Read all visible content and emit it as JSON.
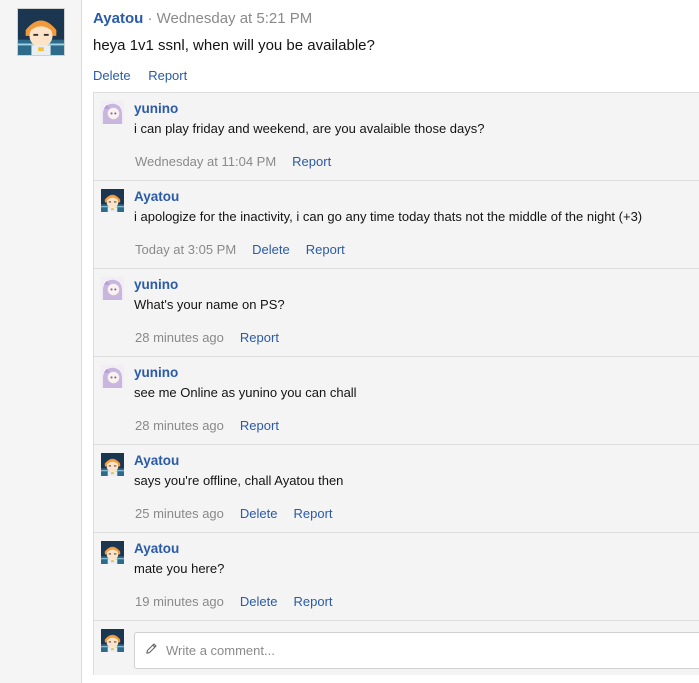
{
  "post": {
    "author": "Ayatou",
    "meta": " · Wednesday at 5:21 PM",
    "body": "heya 1v1 ssnl, when will you be available?",
    "actions": {
      "delete": "Delete",
      "report": "Report"
    }
  },
  "comments": [
    {
      "author": "yunino",
      "text": "i can play friday and weekend, are you avalaible those days?",
      "time": "Wednesday at 11:04 PM",
      "delete": null,
      "report": "Report",
      "avatar": "yunino-avatar"
    },
    {
      "author": "Ayatou",
      "text": "i apologize for the inactivity, i can go any time today thats not the middle of the night (+3)",
      "time": "Today at 3:05 PM",
      "delete": "Delete",
      "report": "Report",
      "avatar": "ayatou-avatar"
    },
    {
      "author": "yunino",
      "text": "What's your name on PS?",
      "time": "28 minutes ago",
      "delete": null,
      "report": "Report",
      "avatar": "yunino-avatar"
    },
    {
      "author": "yunino",
      "text": "see me Online as yunino you can chall",
      "time": "28 minutes ago",
      "delete": null,
      "report": "Report",
      "avatar": "yunino-avatar"
    },
    {
      "author": "Ayatou",
      "text": "says you're offline, chall Ayatou then",
      "time": "25 minutes ago",
      "delete": "Delete",
      "report": "Report",
      "avatar": "ayatou-avatar"
    },
    {
      "author": "Ayatou",
      "text": "mate you here?",
      "time": "19 minutes ago",
      "delete": "Delete",
      "report": "Report",
      "avatar": "ayatou-avatar"
    }
  ],
  "reply": {
    "placeholder": "Write a comment..."
  },
  "colors": {
    "link": "#2a5aa8",
    "meta": "#8a8a8a",
    "comment_bg": "#f4f4f4",
    "border": "#dedede"
  },
  "icons": {
    "reply": "pencil-icon"
  }
}
